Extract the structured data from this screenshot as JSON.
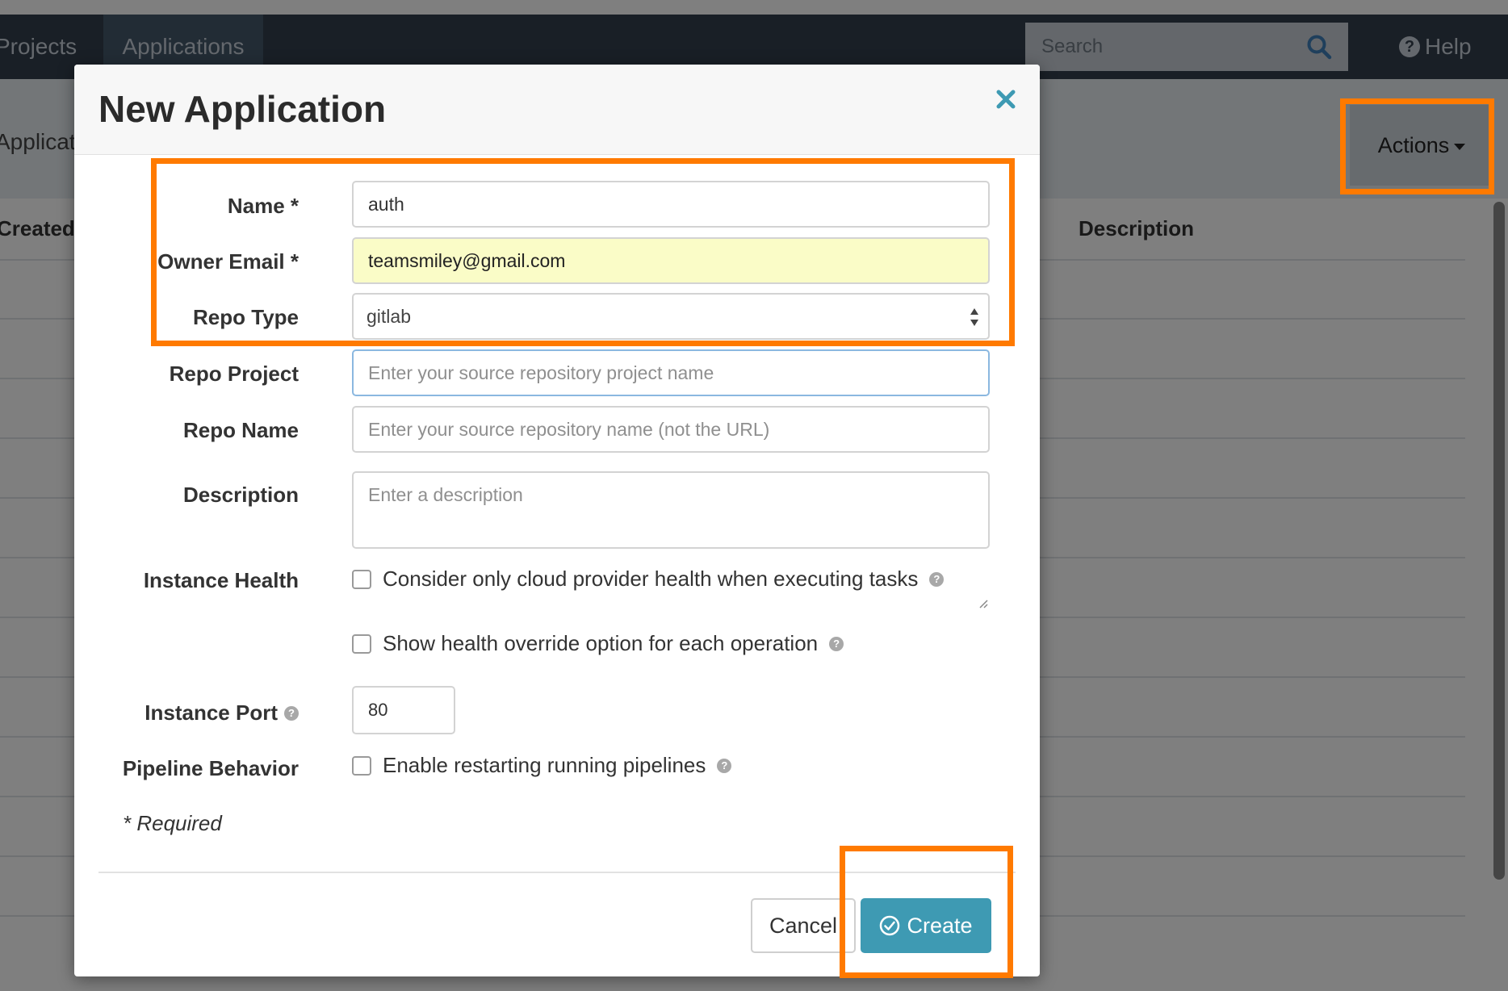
{
  "topbar": {
    "nav": [
      {
        "label": "Projects"
      },
      {
        "label": "Applications"
      }
    ],
    "search": {
      "placeholder": "Search",
      "icon": "search-icon"
    },
    "help": {
      "label": "Help",
      "icon": "help-circle-icon"
    }
  },
  "subbar": {
    "title": "Applications",
    "actions_label": "Actions"
  },
  "table": {
    "headers": {
      "created": "Created",
      "description": "Description"
    }
  },
  "modal": {
    "title": "New Application",
    "close_icon": "close-icon",
    "fields": {
      "name": {
        "label": "Name *",
        "value": "auth"
      },
      "owner_email": {
        "label": "Owner Email *",
        "value": "teamsmiley@gmail.com"
      },
      "repo_type": {
        "label": "Repo Type",
        "value": "gitlab"
      },
      "repo_project": {
        "label": "Repo Project",
        "placeholder": "Enter your source repository project name"
      },
      "repo_name": {
        "label": "Repo Name",
        "placeholder": "Enter your source repository name (not the URL)"
      },
      "description": {
        "label": "Description",
        "placeholder": "Enter a description"
      },
      "instance_health": {
        "label": "Instance Health",
        "options": [
          {
            "text": "Consider only cloud provider health when executing tasks",
            "checked": false
          },
          {
            "text": "Show health override option for each operation",
            "checked": false
          }
        ]
      },
      "instance_port": {
        "label": "Instance Port",
        "value": "80"
      },
      "pipeline_behavior": {
        "label": "Pipeline Behavior",
        "option": {
          "text": "Enable restarting running pipelines",
          "checked": false
        }
      }
    },
    "required_note": "* Required",
    "buttons": {
      "cancel": "Cancel",
      "create": "Create"
    }
  },
  "colors": {
    "topbar": "#333f4d",
    "primary_button": "#3e9ab3",
    "highlight": "#ff7a00",
    "autofill": "#fafcc7"
  }
}
